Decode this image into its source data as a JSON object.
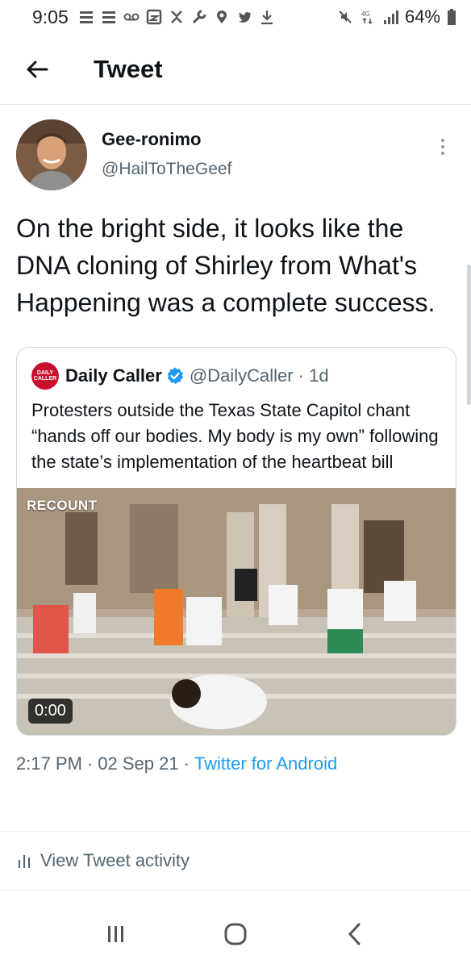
{
  "status_bar": {
    "time": "9:05",
    "battery": "64%",
    "network": "4G"
  },
  "header": {
    "title": "Tweet"
  },
  "tweet": {
    "display_name": "Gee-ronimo",
    "handle": "@HailToTheGeef",
    "text": "On the bright side, it looks like the DNA cloning of Shirley from What's Happening was a complete success.",
    "quote": {
      "avatar_line1": "DAILY",
      "avatar_line2": "CALLER",
      "name": "Daily Caller",
      "handle_time": "@DailyCaller · 1d",
      "text": "Protesters outside the Texas State Capitol chant “hands off our bodies. My body is my own” following the state’s implementation of the heartbeat bill",
      "watermark": "RECOUNT",
      "duration": "0:00"
    },
    "time": "2:17 PM",
    "date": "02 Sep 21",
    "separator": "·",
    "source": "Twitter for Android",
    "activity_label": "View Tweet activity"
  },
  "colors": {
    "accent": "#1d9bf0",
    "secondary_text": "#536471",
    "primary_text": "#0f1419",
    "divider": "#e6ecf0"
  },
  "icons": [
    "back-arrow-icon",
    "more-vertical-icon",
    "verified-badge-icon",
    "bar-chart-icon",
    "recent-apps-icon",
    "home-icon",
    "back-nav-icon"
  ]
}
